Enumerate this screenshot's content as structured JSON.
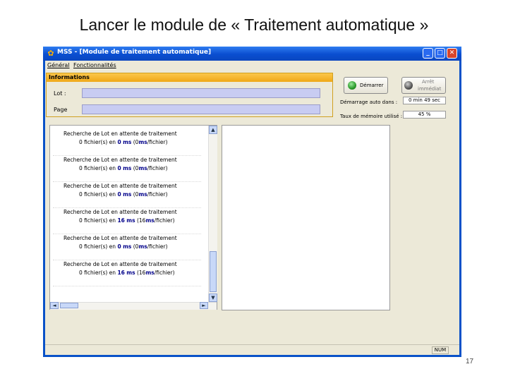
{
  "slide": {
    "title": "Lancer le module de « Traitement automatique »",
    "page_number": "17"
  },
  "window": {
    "title": "MSS - [Module de traitement automatique]",
    "controls": {
      "minimize": "_",
      "maximize": "□",
      "close": "✕"
    }
  },
  "menu": {
    "items": [
      "Général",
      "Fonctionnalités"
    ]
  },
  "info_panel": {
    "header": "Informations",
    "lot_label": "Lot :",
    "lot_value": "",
    "page_label": "Page",
    "page_value": ""
  },
  "controls": {
    "start_button": "Démarrer",
    "stop_button_line1": "Arrêt",
    "stop_button_line2": "immédiat",
    "auto_start_label": "Démarrage auto dans :",
    "auto_start_value": "0 min 49 sec",
    "memory_label": "Taux de mémoire utilisé :",
    "memory_value": "45 %"
  },
  "log": {
    "entries": [
      {
        "line1": "Recherche de Lot en attente de traitement",
        "files": "0 fichier(s) en",
        "ms_value": "0",
        "ms_unit": "ms",
        "rate_prefix": "(0",
        "rate_unit": "ms",
        "rate_suffix": "/fichier)"
      },
      {
        "line1": "Recherche de Lot en attente de traitement",
        "files": "0 fichier(s) en",
        "ms_value": "0",
        "ms_unit": "ms",
        "rate_prefix": "(0",
        "rate_unit": "ms",
        "rate_suffix": "/fichier)"
      },
      {
        "line1": "Recherche de Lot en attente de traitement",
        "files": "0 fichier(s) en",
        "ms_value": "0",
        "ms_unit": "ms",
        "rate_prefix": "(0",
        "rate_unit": "ms",
        "rate_suffix": "/fichier)"
      },
      {
        "line1": "Recherche de Lot en attente de traitement",
        "files": "0 fichier(s) en",
        "ms_value": "16",
        "ms_unit": "ms",
        "rate_prefix": "(16",
        "rate_unit": "ms",
        "rate_suffix": "/fichier)"
      },
      {
        "line1": "Recherche de Lot en attente de traitement",
        "files": "0 fichier(s) en",
        "ms_value": "0",
        "ms_unit": "ms",
        "rate_prefix": "(0",
        "rate_unit": "ms",
        "rate_suffix": "/fichier)"
      },
      {
        "line1": "Recherche de Lot en attente de traitement",
        "files": "0 fichier(s) en",
        "ms_value": "16",
        "ms_unit": "ms",
        "rate_prefix": "(16",
        "rate_unit": "ms",
        "rate_suffix": "/fichier)"
      }
    ],
    "scroll_up": "▲",
    "scroll_down": "▼",
    "scroll_left": "◄",
    "scroll_right": "►"
  },
  "statusbar": {
    "num": "NUM"
  },
  "colors": {
    "title_bar": "#0a4ed0",
    "info_header": "#f0a818",
    "input_fill": "#c8ccf2",
    "start_icon": "#2a9a2a",
    "stop_icon": "#555555"
  }
}
